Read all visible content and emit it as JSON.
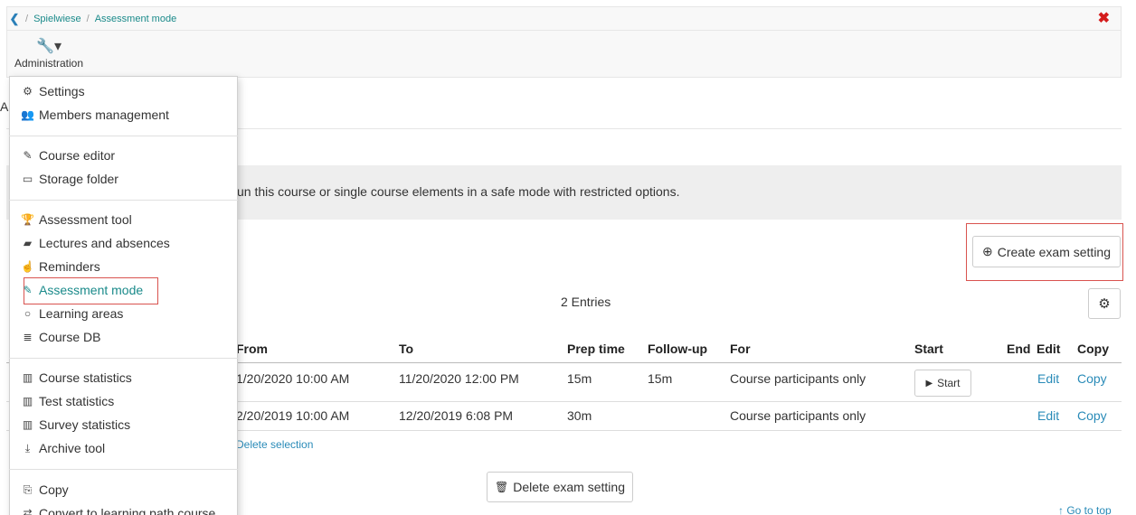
{
  "breadcrumb": {
    "back": "❮",
    "items": [
      "Spielwiese",
      "Assessment mode"
    ]
  },
  "toolbar": {
    "close": "✖",
    "admin_label": "Administration",
    "wrench": "🔧▾"
  },
  "intro_text": "un this course or single course elements in a safe mode with restricted options.",
  "create_button": {
    "label": "Create exam setting",
    "icon": "⊕"
  },
  "entries_label": "2 Entries",
  "gear": "⚙",
  "table": {
    "headers": [
      "From",
      "To",
      "Prep time",
      "Follow-up",
      "For",
      "Start",
      "End",
      "Edit",
      "Copy"
    ],
    "rows": [
      {
        "from": "1/20/2020 10:00 AM",
        "to": "11/20/2020 12:00 PM",
        "prep": "15m",
        "follow": "15m",
        "for": "Course participants only",
        "start": "Start",
        "edit": "Edit",
        "copy": "Copy"
      },
      {
        "from": "2/20/2019 10:00 AM",
        "to": "12/20/2019 6:08 PM",
        "prep": "30m",
        "follow": "",
        "for": "Course participants only",
        "start": "",
        "edit": "Edit",
        "copy": "Copy"
      }
    ]
  },
  "delete_selection": "Delete selection",
  "delete_button": {
    "label": "Delete exam setting",
    "icon": "🗑"
  },
  "goto_top": "↑ Go to top",
  "menu": [
    {
      "label": "Settings",
      "icon": "⚙"
    },
    {
      "label": "Members management",
      "icon": "👥"
    },
    {
      "label": "Course editor",
      "icon": "✎"
    },
    {
      "label": "Storage folder",
      "icon": "▭"
    },
    {
      "label": "Assessment tool",
      "icon": "🏆"
    },
    {
      "label": "Lectures and absences",
      "icon": "▰"
    },
    {
      "label": "Reminders",
      "icon": "☝"
    },
    {
      "label": "Assessment mode",
      "icon": "✎"
    },
    {
      "label": "Learning areas",
      "icon": "○"
    },
    {
      "label": "Course DB",
      "icon": "≣"
    },
    {
      "label": "Course statistics",
      "icon": "▥"
    },
    {
      "label": "Test statistics",
      "icon": "▥"
    },
    {
      "label": "Survey statistics",
      "icon": "▥"
    },
    {
      "label": "Archive tool",
      "icon": "⤓"
    },
    {
      "label": "Copy",
      "icon": "⎘"
    },
    {
      "label": "Convert to learning path course",
      "icon": "⇄"
    }
  ]
}
